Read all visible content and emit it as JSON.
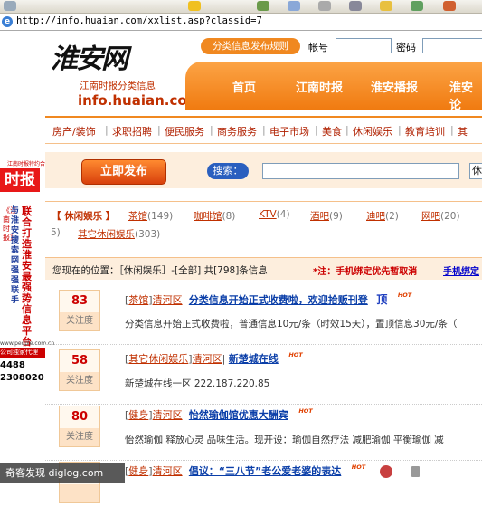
{
  "browser": {
    "url": "http://info.huaian.com/xxlist.asp?classid=7"
  },
  "left_ad": {
    "small": "江南时报特约合作",
    "brand": "时报",
    "col1": "《江南时报》",
    "col2": "与淮安搜索网强强联手",
    "col3": "联合打造淮安最强势信息平台",
    "col4": "",
    "site": "www.people.com.cn 分类广告",
    "agency": "公司独家代理",
    "tel1": "4488",
    "tel2": "2308020"
  },
  "header": {
    "logo_script": "淮安网",
    "logo_sub": "江南时报分类信息",
    "logo_domain": "info.huaian.com",
    "rules_button": "分类信息发布规则",
    "account_label": "帐号",
    "password_label": "密码",
    "main_nav": [
      "首页",
      "江南时报",
      "淮安播报",
      "淮安论"
    ]
  },
  "sub_nav": [
    "房产/装饰",
    "求职招聘",
    "便民服务",
    "商务服务",
    "电子市场",
    "美食",
    "休闲娱乐",
    "教育培训",
    "其"
  ],
  "search": {
    "publish_button": "立即发布",
    "label": "搜索：",
    "select_value": "休"
  },
  "categories": {
    "current": "【 休闲娱乐 】",
    "items": [
      {
        "name": "茶馆",
        "count": "(149)"
      },
      {
        "name": "咖啡馆",
        "count": "(8)"
      },
      {
        "name": "KTV",
        "count": "(4)"
      },
      {
        "name": "酒吧",
        "count": "(9)"
      },
      {
        "name": "迪吧",
        "count": "(2)"
      },
      {
        "name": "网吧",
        "count": "(20)"
      }
    ],
    "overflow_count": "5)",
    "other": {
      "name": "其它休闲娱乐",
      "count": "(303)"
    }
  },
  "location": {
    "text": "您现在的位置：［休闲娱乐］-[全部]  共[798]条信息",
    "notice": "*注：手机绑定优先暂取消",
    "link": "手机绑定"
  },
  "posts": [
    {
      "score": "83",
      "score_label": "关注度",
      "tag": "茶馆",
      "area": "清河区",
      "title": "分类信息开始正式收费啦，欢迎拾贩刊登",
      "top": "顶",
      "hot": "HOT",
      "desc": "分类信息开始正式收费啦，普通信息10元/条（时效15天），置顶信息30元/条（"
    },
    {
      "score": "58",
      "score_label": "关注度",
      "tag": "其它休闲娱乐",
      "area": "清河区",
      "title": "新楚城在线",
      "top": "",
      "hot": "HOT",
      "desc": "新楚城在线一区 222.187.220.85"
    },
    {
      "score": "80",
      "score_label": "关注度",
      "tag": "健身",
      "area": "清河区",
      "title": "怡然瑜伽馆优惠大酬宾",
      "top": "",
      "hot": "HOT",
      "desc": "怡然瑜伽 释放心灵 品味生活。现开设：瑜伽自然疗法 减肥瑜伽 平衡瑜伽 减"
    },
    {
      "score": "",
      "score_label": "",
      "tag": "健身",
      "area": "清河区",
      "title": "倡议：“三八节”老公爱老婆的表达",
      "top": "",
      "hot": "HOT",
      "desc": ""
    }
  ],
  "watermark": "奇客发现 diglog.com",
  "colors": {
    "accent": "#f08820",
    "title_blue": "#0a3ea8",
    "link_red": "#c03000"
  }
}
